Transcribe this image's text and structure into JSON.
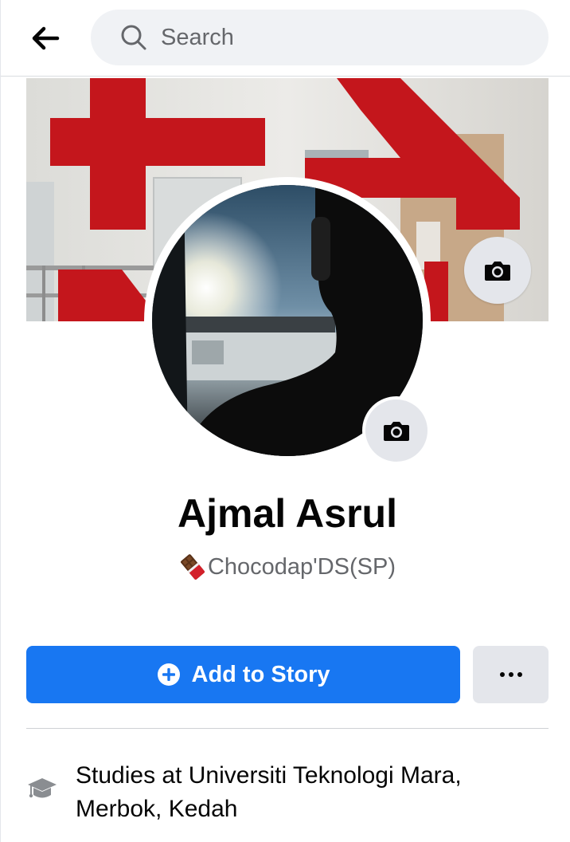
{
  "search": {
    "placeholder": "Search"
  },
  "profile": {
    "name": "Ajmal Asrul",
    "bio": "Chocodap'DS(SP)",
    "bio_icon": "chocolate-bar-emoji"
  },
  "actions": {
    "add_to_story": "Add to Story",
    "more": "•••"
  },
  "intro": {
    "education": "Studies at Universiti Teknologi Mara, Merbok, Kedah"
  },
  "colors": {
    "accent": "#1877f2",
    "secondary_button": "#e4e6eb",
    "search_bg": "#f0f2f5",
    "text_primary": "#050505",
    "text_secondary": "#65676b"
  },
  "icons": {
    "back": "arrow-left-icon",
    "search": "search-icon",
    "cover_camera": "camera-icon",
    "avatar_camera": "camera-icon",
    "story": "plus-circle-icon",
    "education": "graduation-cap-icon"
  }
}
